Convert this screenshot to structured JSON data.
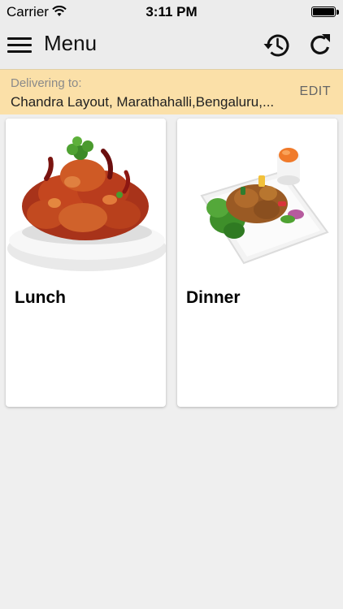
{
  "status_bar": {
    "carrier": "Carrier",
    "time": "3:11 PM"
  },
  "nav": {
    "title": "Menu",
    "left_icon": "hamburger-menu-icon",
    "right_icons": [
      "history-icon",
      "refresh-icon"
    ]
  },
  "delivery": {
    "label": "Delivering to:",
    "address": "Chandra Layout, Marathahalli,Bengaluru,...",
    "edit_label": "EDIT",
    "background": "#fbe0a8"
  },
  "cards": [
    {
      "title": "Lunch",
      "image": "fried-chicken-bowl"
    },
    {
      "title": "Dinner",
      "image": "dinner-plate-with-sauce"
    }
  ]
}
